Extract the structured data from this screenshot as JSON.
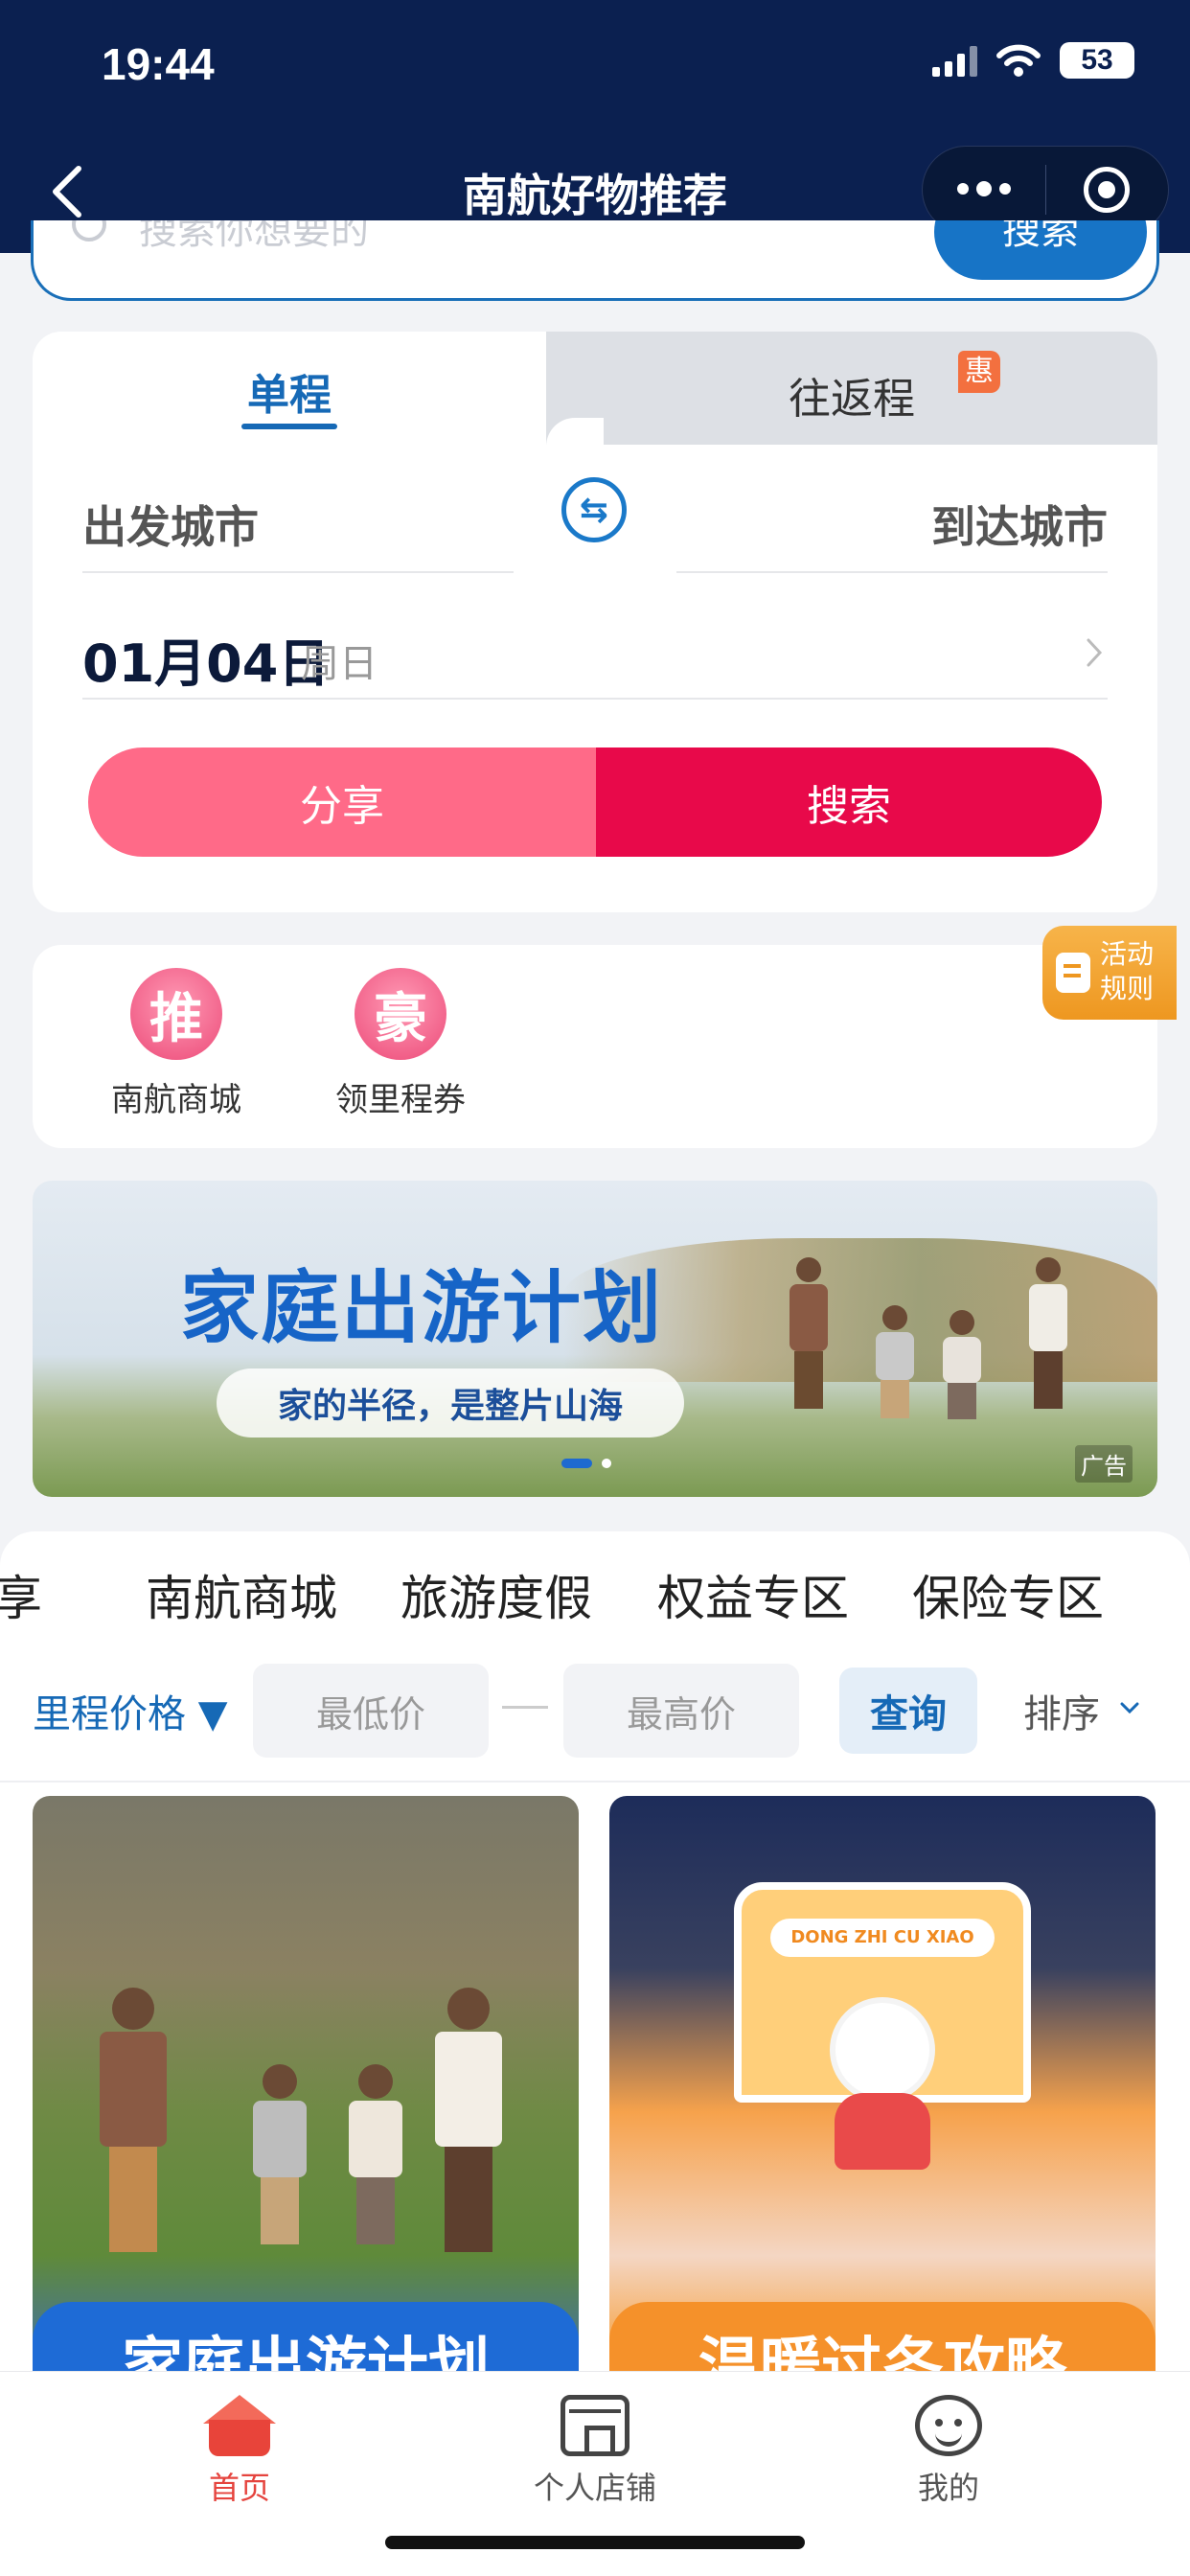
{
  "status_bar": {
    "time": "19:44",
    "battery": "53"
  },
  "nav": {
    "title": "南航好物推荐"
  },
  "search": {
    "placeholder": "搜索你想要的",
    "button": "搜索"
  },
  "booking": {
    "tabs": [
      {
        "label": "单程",
        "active": true
      },
      {
        "label": "往返程",
        "badge": "惠"
      }
    ],
    "from_city": "出发城市",
    "to_city": "到达城市",
    "date": "01月04日",
    "weekday": "周日",
    "share_button": "分享",
    "search_button": "搜索"
  },
  "quick_entries": [
    {
      "icon_char": "推",
      "label": "南航商城"
    },
    {
      "icon_char": "豪",
      "label": "领里程券"
    }
  ],
  "activity_rules": {
    "line1": "活动",
    "line2": "规则"
  },
  "banner": {
    "title": "家庭出游计划",
    "subtitle": "家的半径，是整片山海",
    "ad_tag": "广告"
  },
  "categories": [
    "享",
    "南航商城",
    "旅游度假",
    "权益专区",
    "保险专区"
  ],
  "filter": {
    "price_label": "里程价格 ▼",
    "min_placeholder": "最低价",
    "max_placeholder": "最高价",
    "query_button": "查询",
    "sort_label": "排序"
  },
  "products": [
    {
      "caption": "家庭出游计划"
    },
    {
      "caption": "温暖过冬攻略",
      "store_sign": "DONG ZHI CU XIAO"
    }
  ],
  "tabbar": [
    {
      "label": "首页",
      "active": true
    },
    {
      "label": "个人店铺"
    },
    {
      "label": "我的"
    }
  ],
  "colors": {
    "nav_bg": "#0b2050",
    "primary_blue": "#1669b6",
    "share_pink": "#ff6a88",
    "search_red": "#e8094a",
    "active_tab": "#e5443e"
  }
}
